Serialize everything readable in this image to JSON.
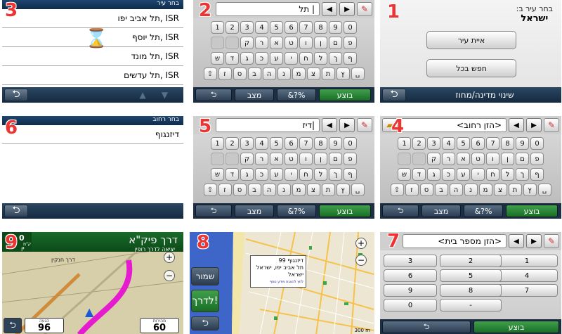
{
  "steps": [
    "1",
    "2",
    "3",
    "4",
    "5",
    "6",
    "7",
    "8",
    "9"
  ],
  "panel1": {
    "heading_line1": "בחר עיר ב:",
    "heading_line2": "ישראל",
    "btn_spell_city": "איית עיר",
    "btn_search_all": "חפש בכל",
    "change_region": "שינוי מדינה/מחוז"
  },
  "keyboard": {
    "row1": [
      "1",
      "2",
      "3",
      "4",
      "5",
      "6",
      "7",
      "8",
      "9",
      "0"
    ],
    "row2": [
      "",
      "",
      "ק",
      "ר",
      "א",
      "ט",
      "ו",
      "ן",
      "ם",
      "פ"
    ],
    "row3": [
      "ש",
      "ד",
      "ג",
      "כ",
      "ע",
      "י",
      "ח",
      "ל",
      "ך",
      "ף"
    ],
    "row4": [
      "⇧",
      "ז",
      "ס",
      "ב",
      "ה",
      "נ",
      "מ",
      "צ",
      "ת",
      "ץ",
      "␣"
    ],
    "go": "בוצע",
    "symbols": "&?%",
    "mode": "מצב",
    "back": "⮌"
  },
  "panel2": {
    "input": "תל |"
  },
  "panel3": {
    "header": "בחר עיר",
    "rows": [
      "תל אביב יפו, ISR",
      "תל יוסף, ISR",
      "תל מונד, ISR",
      "תל עדשים, ISR"
    ]
  },
  "panel4": {
    "input": "<הזן רחוב>"
  },
  "panel5": {
    "input": "דיז|"
  },
  "panel6": {
    "header": "בחר רחוב",
    "rows": [
      "דיזנגוף"
    ]
  },
  "panel7": {
    "input": "<הזן מספר בית>",
    "keys": [
      "1",
      "2",
      "3",
      "4",
      "5",
      "6",
      "7",
      "8",
      "9",
      "0",
      "-"
    ],
    "go": "בוצע"
  },
  "panel8": {
    "popup_line1": "דיזנגוף 99",
    "popup_line2": "תל אביב יפו, ישראל",
    "popup_line3": "ישראל",
    "popup_small": "לחץ להצגת מידע נוסף",
    "save": "שמור",
    "go": "לדרך!",
    "scale": "300 m"
  },
  "panel9": {
    "street": "דרך פיק\"א",
    "sub1": "יציאה לדרך רופין",
    "sub2": "דרך חנקין",
    "dist": "0",
    "dist_unit": "ק\"מ",
    "arrival_caption": "הגעה",
    "arrival_value": "96",
    "speed_caption": "מהירות",
    "speed_value": "60"
  },
  "colors": {
    "accent": "#e33333",
    "go": "#1a6e26",
    "bar": "#142a40"
  }
}
